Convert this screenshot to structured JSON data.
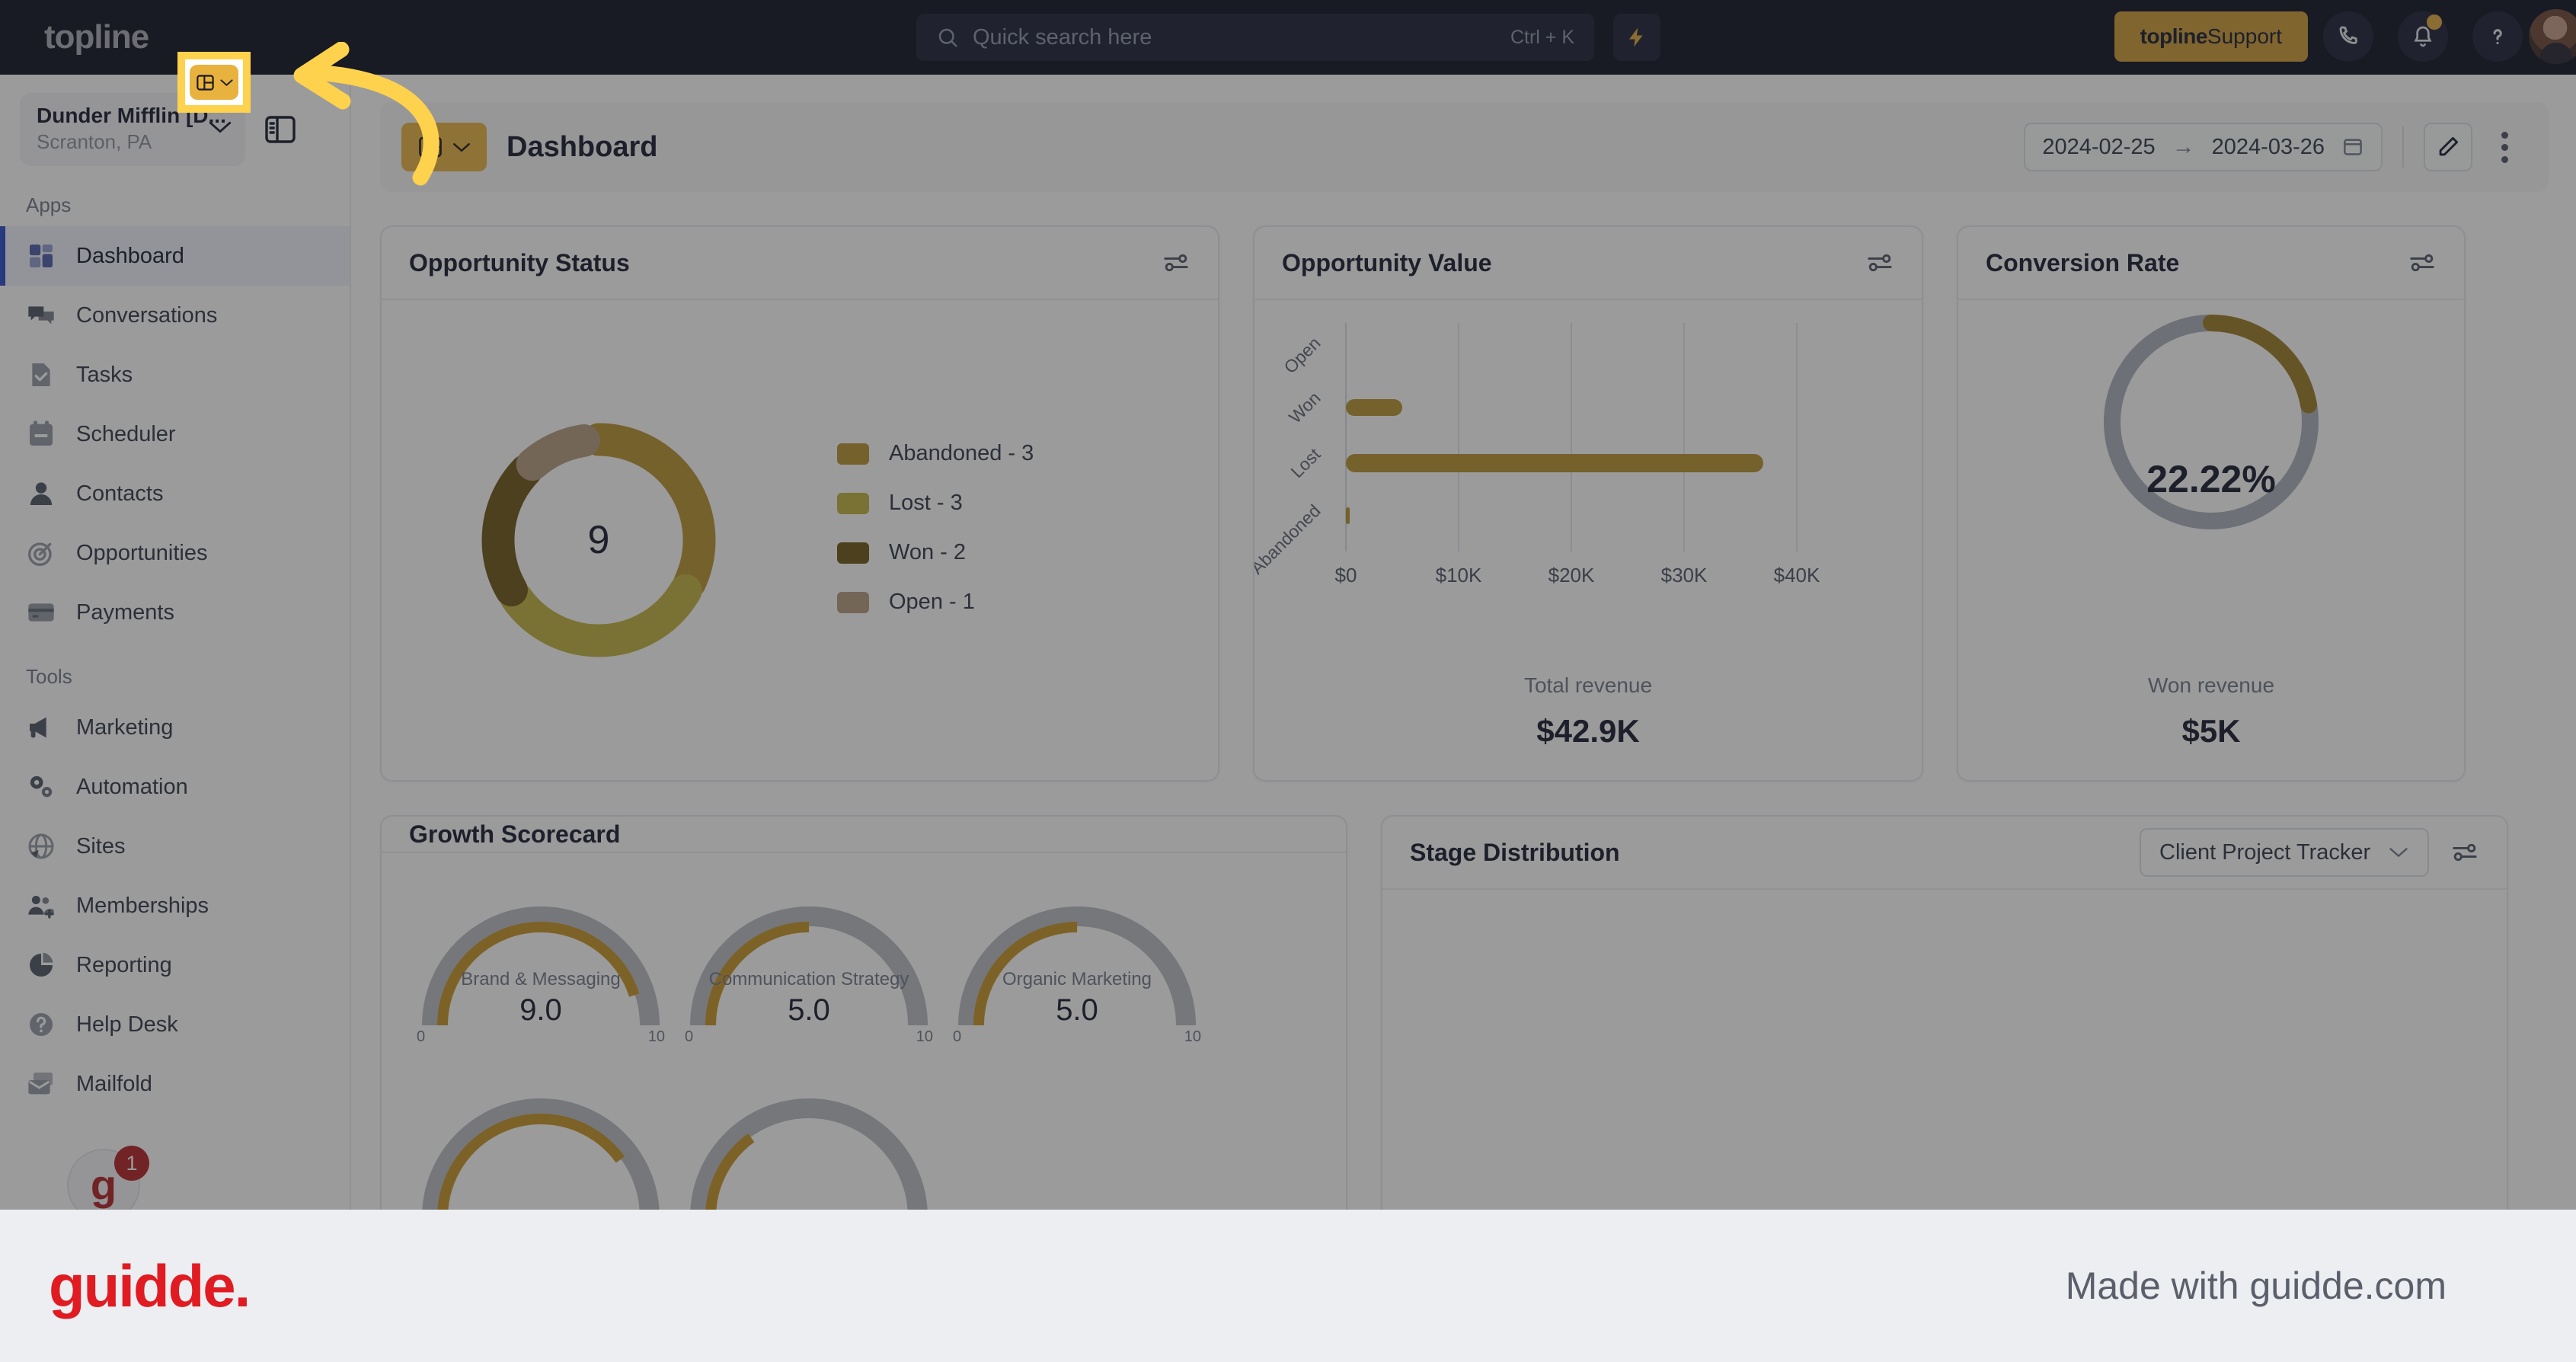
{
  "topbar": {
    "logo": "topline",
    "search": {
      "placeholder": "Quick search here",
      "shortcut": "Ctrl + K",
      "icon": "search-icon"
    },
    "bolt_icon": "lightning-bolt-icon",
    "support_brand": "topline",
    "support_label": " Support",
    "phone_icon": "phone-icon",
    "bell_icon": "bell-icon",
    "help_icon": "question-mark-icon",
    "avatar": "user-avatar"
  },
  "sidebar": {
    "workspace": {
      "name": "Dunder Mifflin [D...",
      "location": "Scranton, PA"
    },
    "panel_toggle_icon": "panel-toggle-icon",
    "sections": [
      {
        "label": "Apps",
        "items": [
          {
            "label": "Dashboard",
            "icon": "dashboard-icon",
            "active": true
          },
          {
            "label": "Conversations",
            "icon": "chat-bubbles-icon",
            "active": false
          },
          {
            "label": "Tasks",
            "icon": "task-document-icon",
            "active": false
          },
          {
            "label": "Scheduler",
            "icon": "calendar-icon",
            "active": false
          },
          {
            "label": "Contacts",
            "icon": "person-icon",
            "active": false
          },
          {
            "label": "Opportunities",
            "icon": "target-icon",
            "active": false
          },
          {
            "label": "Payments",
            "icon": "credit-card-icon",
            "active": false
          }
        ]
      },
      {
        "label": "Tools",
        "items": [
          {
            "label": "Marketing",
            "icon": "megaphone-icon",
            "active": false
          },
          {
            "label": "Automation",
            "icon": "gears-icon",
            "active": false
          },
          {
            "label": "Sites",
            "icon": "globe-icon",
            "active": false
          },
          {
            "label": "Memberships",
            "icon": "people-add-icon",
            "active": false
          },
          {
            "label": "Reporting",
            "icon": "pie-chart-icon",
            "active": false
          },
          {
            "label": "Help Desk",
            "icon": "help-circle-icon",
            "active": false
          },
          {
            "label": "Mailfold",
            "icon": "mail-stack-icon",
            "active": false
          }
        ]
      }
    ],
    "widget_badge": "1"
  },
  "page_header": {
    "dashboard_switch_icon": "layout-panel-icon",
    "dashboard_switch_chevron": "chevron-down-icon",
    "title": "Dashboard",
    "date_start": "2024-02-25",
    "date_arrow": "→",
    "date_end": "2024-03-26",
    "calendar_icon": "calendar-icon",
    "edit_icon": "pencil-icon",
    "more_icon": "more-vertical-icon"
  },
  "annotation": {
    "highlight_target": "dashboard-switch-button",
    "arrow": "curved-arrow-pointing-left",
    "highlight_color": "#ffd24d"
  },
  "cards": {
    "opportunity_status": {
      "title": "Opportunity Status",
      "settings_icon": "sliders-icon",
      "center_total": "9"
    },
    "opportunity_value": {
      "title": "Opportunity Value",
      "settings_icon": "sliders-icon",
      "total_label": "Total revenue",
      "total_value": "$42.9K"
    },
    "conversion_rate": {
      "title": "Conversion Rate",
      "settings_icon": "sliders-icon",
      "value": "22.22%",
      "sub_label": "Won revenue",
      "sub_value": "$5K"
    },
    "growth_scorecard": {
      "title": "Growth Scorecard"
    },
    "stage_distribution": {
      "title": "Stage Distribution",
      "selected_pipeline": "Client Project Tracker",
      "chevron_icon": "chevron-down-icon",
      "settings_icon": "sliders-icon"
    }
  },
  "chart_data": [
    {
      "type": "pie",
      "title": "Opportunity Status",
      "center_label": "9",
      "legend_position": "right",
      "labels": [
        "Abandoned",
        "Lost",
        "Won",
        "Open"
      ],
      "values": [
        3,
        3,
        2,
        1
      ],
      "legend": [
        "Abandoned - 3",
        "Lost - 3",
        "Won - 2",
        "Open - 1"
      ],
      "colors": [
        "#b8912c",
        "#bfb23d",
        "#6b5415",
        "#b69b7d"
      ]
    },
    {
      "type": "bar",
      "title": "Opportunity Value",
      "orientation": "horizontal",
      "categories": [
        "Open",
        "Won",
        "Lost",
        "Abandoned"
      ],
      "values": [
        0,
        5000,
        37000,
        300
      ],
      "xlabel": "",
      "ylabel": "",
      "xlim": [
        0,
        42000
      ],
      "xticks": [
        "$0",
        "$10K",
        "$20K",
        "$30K",
        "$40K"
      ],
      "grid": true,
      "color": "#b8912c",
      "total_label": "Total revenue",
      "total_value": "$42.9K"
    },
    {
      "type": "pie",
      "title": "Conversion Rate",
      "subtype": "gauge-donut",
      "value": 22.22,
      "value_label": "22.22%",
      "ylim": [
        0,
        100
      ],
      "track_color": "#a9aeba",
      "color": "#9a7b22",
      "sub_label": "Won revenue",
      "sub_value": "$5K"
    },
    {
      "type": "bar",
      "title": "Growth Scorecard",
      "subtype": "gauge-arcs",
      "categories": [
        "Brand & Messaging",
        "Communication Strategy",
        "Organic Marketing"
      ],
      "values": [
        9.0,
        5.0,
        5.0
      ],
      "value_labels": [
        "9.0",
        "5.0",
        "5.0"
      ],
      "scale_min": "0",
      "scale_max": "10",
      "ylim": [
        0,
        10
      ],
      "color": "#c79424",
      "track_color": "#b8bbc2"
    }
  ],
  "footer": {
    "logo": "guidde.",
    "made_with": "Made with guidde.com"
  }
}
